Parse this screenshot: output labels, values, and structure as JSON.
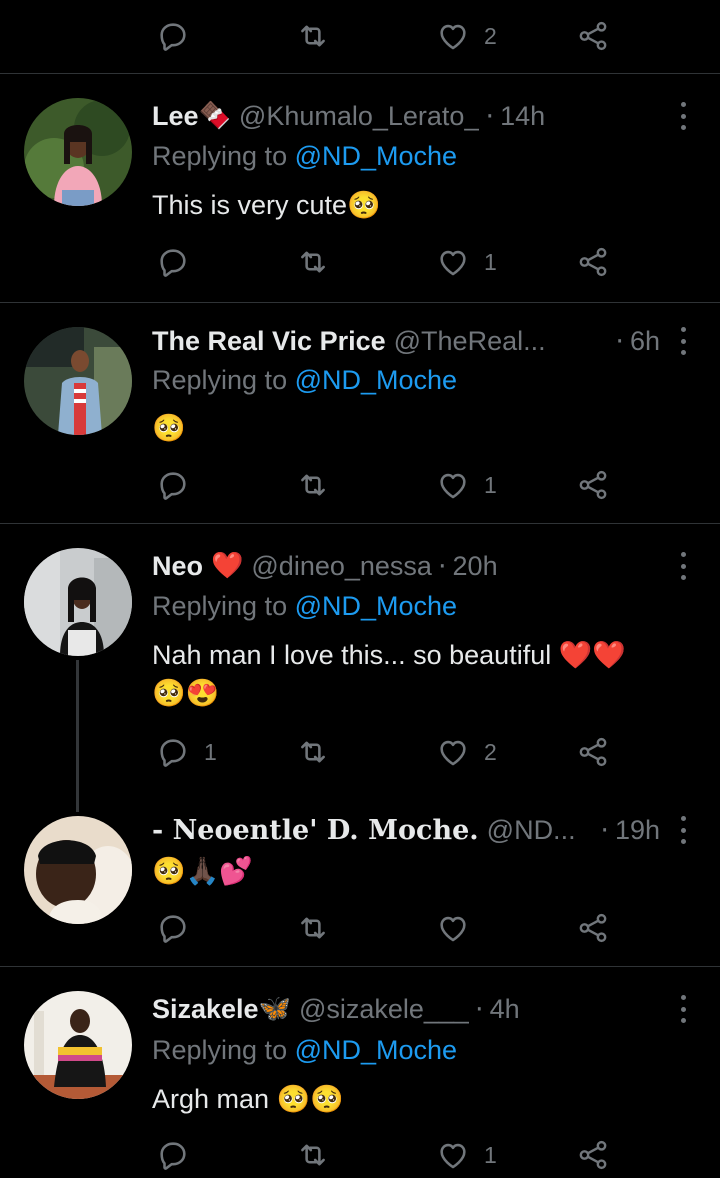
{
  "top_actions": {
    "like_count": "2"
  },
  "replies": [
    {
      "name": "Lee",
      "name_emoji": "🍫",
      "handle": "@Khumalo_Lerato_",
      "time": "14h",
      "replying_label": "Replying to",
      "replying_to": "@ND_Moche",
      "text": "This is very cute🥺",
      "reply_count": "",
      "like_count": "1"
    },
    {
      "name": "The Real Vic Price",
      "name_emoji": "",
      "handle": "@TheReal...",
      "time": "6h",
      "replying_label": "Replying to",
      "replying_to": "@ND_Moche",
      "text": "🥺",
      "reply_count": "",
      "like_count": "1"
    },
    {
      "name": "Neo",
      "name_emoji": "❤️",
      "handle": "@dineo_nessa",
      "time": "20h",
      "replying_label": "Replying to",
      "replying_to": "@ND_Moche",
      "text": "Nah man I love this... so beautiful ❤️❤️",
      "text_line2": "🥺😍",
      "reply_count": "1",
      "like_count": "2"
    },
    {
      "name": "- Neoentle' D. Moche.",
      "name_emoji": "",
      "handle": "@ND...",
      "time": "19h",
      "text": "🥺🙏🏿💕",
      "reply_count": "",
      "like_count": ""
    },
    {
      "name": "Sizakele",
      "name_emoji": "🦋",
      "handle": "@sizakele___",
      "time": "4h",
      "replying_label": "Replying to",
      "replying_to": "@ND_Moche",
      "text": "Argh man 🥺🥺",
      "reply_count": "",
      "like_count": "1"
    }
  ]
}
